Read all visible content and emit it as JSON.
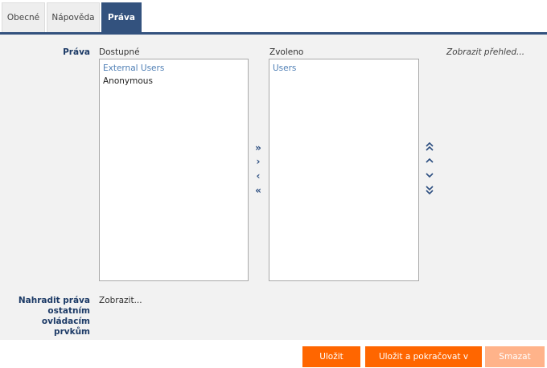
{
  "tabs": [
    {
      "label": "Obecné",
      "active": false
    },
    {
      "label": "Nápověda",
      "active": false
    },
    {
      "label": "Práva",
      "active": true
    }
  ],
  "rights": {
    "label": "Práva",
    "available_label": "Dostupné",
    "selected_label": "Zvoleno",
    "overview_link": "Zobrazit přehled...",
    "available_items": [
      "External Users",
      "Anonymous"
    ],
    "selected_items": [
      "Users"
    ]
  },
  "replace": {
    "label_lines": [
      "Nahradit práva",
      "ostatním",
      "ovládacím",
      "prvkům"
    ],
    "link": "Zobrazit..."
  },
  "transfer_icons": [
    "double-chevron-right-icon",
    "chevron-right-icon",
    "chevron-left-icon",
    "double-chevron-left-icon"
  ],
  "order_icons": [
    "double-chevron-up-icon",
    "chevron-up-icon",
    "chevron-down-icon",
    "double-chevron-down-icon"
  ],
  "buttons": {
    "save": "Uložit",
    "save_continue": "Uložit a pokračovat v editaci",
    "delete": "Smazat"
  },
  "colors": {
    "tab_active": "#33527e",
    "button": "#ff6600",
    "button_disabled": "#ffb38a",
    "label": "#1c3a66",
    "panel_bg": "#f2f2f2"
  }
}
